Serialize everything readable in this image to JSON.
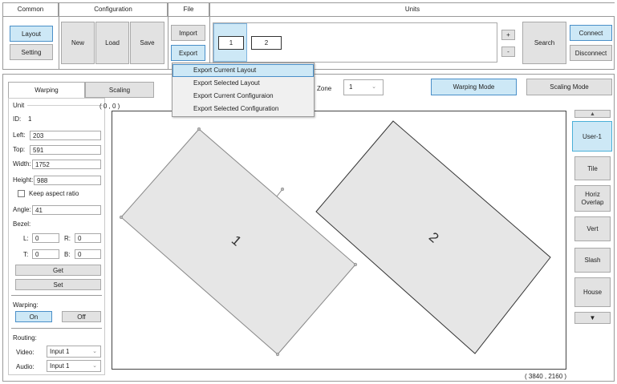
{
  "ribbon": {
    "groups": {
      "common": "Common",
      "configuration": "Configuration",
      "file": "File",
      "units": "Units"
    },
    "common": {
      "layout": "Layout",
      "setting": "Setting"
    },
    "configuration": {
      "new": "New",
      "load": "Load",
      "save": "Save"
    },
    "file": {
      "import": "Import",
      "export": "Export"
    },
    "units": {
      "unit_1": "1",
      "unit_2": "2",
      "plus": "+",
      "minus": "-",
      "search": "Search",
      "connect": "Connect",
      "disconnect": "Disconnect"
    }
  },
  "export_menu": {
    "items": [
      "Export Current Layout",
      "Export Selected Layout",
      "Export Current Configuraion",
      "Export Selected Configuration"
    ]
  },
  "tabs": {
    "warping": "Warping",
    "scaling": "Scaling"
  },
  "toolbar": {
    "zone_label": "Zone",
    "zone_value": "1",
    "zone_arrow": "⌄",
    "warping_mode": "Warping Mode",
    "scaling_mode": "Scaling Mode"
  },
  "panel": {
    "unit_title": "Unit",
    "id_label": "ID:",
    "id_value": "1",
    "left_label": "Left:",
    "left_value": "203",
    "top_label": "Top:",
    "top_value": "591",
    "width_label": "Width:",
    "width_value": "1752",
    "height_label": "Height:",
    "height_value": "988",
    "keep_aspect": "Keep aspect ratio",
    "angle_label": "Angle:",
    "angle_value": "41",
    "bezel_label": "Bezel:",
    "l_label": "L:",
    "l_value": "0",
    "r_label": "R:",
    "r_value": "0",
    "t_label": "T:",
    "t_value": "0",
    "b_label": "B:",
    "b_value": "0",
    "get": "Get",
    "set": "Set",
    "warping_label": "Warping:",
    "on": "On",
    "off": "Off",
    "routing_label": "Routing:",
    "video_label": "Video:",
    "video_value": "Input 1",
    "audio_label": "Audio:",
    "audio_value": "Input 1",
    "select_arrow": "⌄"
  },
  "canvas": {
    "origin": "( 0 , 0 )",
    "extent": "( 3840 , 2160 )",
    "display_1": "1",
    "display_2": "2"
  },
  "presets": {
    "up_arrow": "▲",
    "down_arrow": "▼",
    "items": [
      "User-1",
      "Tile",
      "Horiz Overlap",
      "Vert",
      "Slash",
      "House"
    ]
  }
}
